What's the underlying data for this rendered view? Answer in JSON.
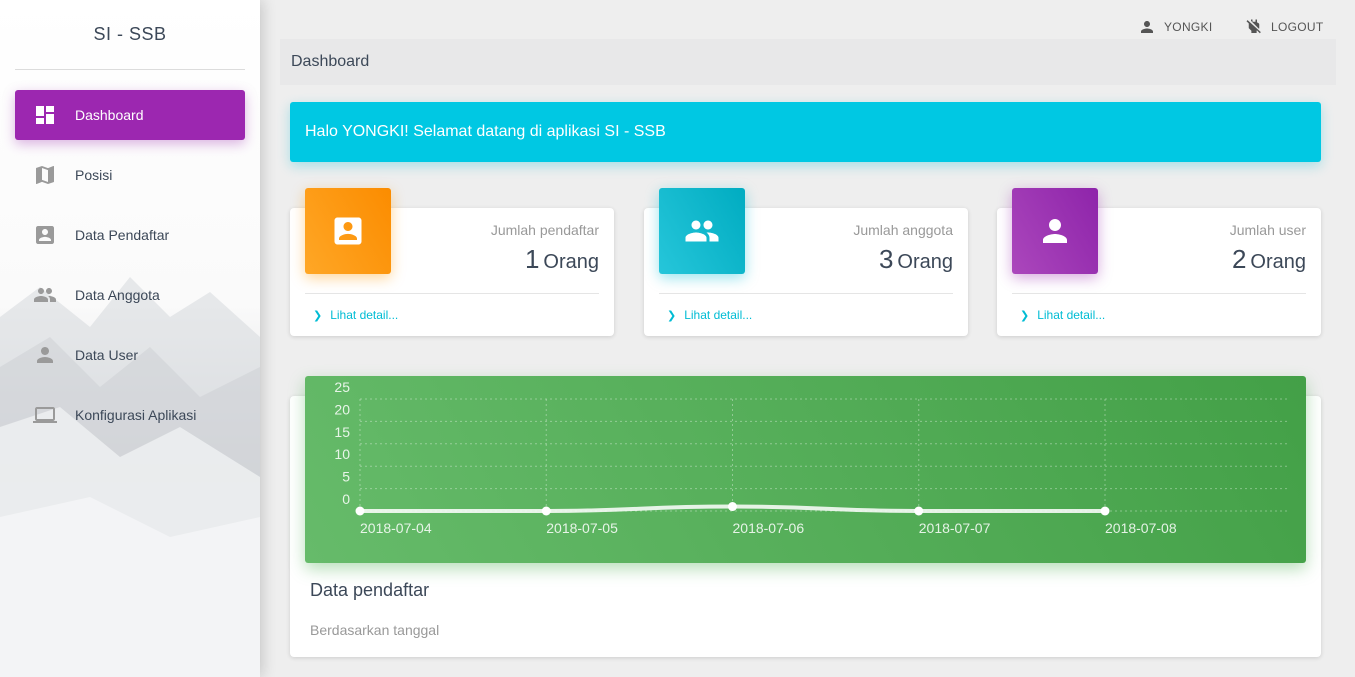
{
  "sidebar": {
    "brand": "SI - SSB",
    "items": [
      {
        "label": "Dashboard",
        "icon": "dashboard-icon"
      },
      {
        "label": "Posisi",
        "icon": "map-icon"
      },
      {
        "label": "Data Pendaftar",
        "icon": "account-box-icon"
      },
      {
        "label": "Data Anggota",
        "icon": "people-icon"
      },
      {
        "label": "Data User",
        "icon": "person-icon"
      },
      {
        "label": "Konfigurasi Aplikasi",
        "icon": "laptop-icon"
      }
    ]
  },
  "topbar": {
    "user_label": "YONGKI",
    "logout_label": "LOGOUT"
  },
  "breadcrumb": {
    "title": "Dashboard"
  },
  "welcome": {
    "message": "Halo YONGKI! Selamat datang di aplikasi SI - SSB"
  },
  "stats": [
    {
      "category": "Jumlah pendaftar",
      "value": "1",
      "unit": "Orang",
      "link": "Lihat detail...",
      "color": "#fb8c00"
    },
    {
      "category": "Jumlah anggota",
      "value": "3",
      "unit": "Orang",
      "link": "Lihat detail...",
      "color": "#00acc1"
    },
    {
      "category": "Jumlah user",
      "value": "2",
      "unit": "Orang",
      "link": "Lihat detail...",
      "color": "#8e24aa"
    }
  ],
  "chart": {
    "title": "Data pendaftar",
    "subtitle": "Berdasarkan tanggal"
  },
  "chart_data": {
    "type": "line",
    "categories": [
      "2018-07-04",
      "2018-07-05",
      "2018-07-06",
      "2018-07-07",
      "2018-07-08"
    ],
    "values": [
      0,
      0,
      1,
      0,
      0
    ],
    "title": "Data pendaftar",
    "xlabel": "",
    "ylabel": "",
    "ylim": [
      0,
      25
    ],
    "yticks": [
      0,
      5,
      10,
      15,
      20,
      25
    ],
    "grid": true,
    "background": "#4caf50",
    "line_color": "#ffffff"
  }
}
